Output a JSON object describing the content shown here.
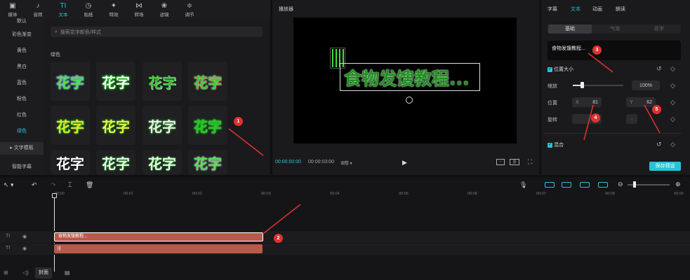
{
  "topnav": {
    "items": [
      {
        "label": "媒体",
        "icon": "▣"
      },
      {
        "label": "音频",
        "icon": "♪"
      },
      {
        "label": "文本",
        "icon": "TI"
      },
      {
        "label": "贴纸",
        "icon": "◷"
      },
      {
        "label": "特效",
        "icon": "✦"
      },
      {
        "label": "转场",
        "icon": "⋈"
      },
      {
        "label": "滤镜",
        "icon": "❀"
      },
      {
        "label": "调节",
        "icon": "≑"
      }
    ]
  },
  "sidebar": {
    "items": [
      "默认",
      "彩色渐变",
      "黄色",
      "黑白",
      "蓝色",
      "粉色",
      "红色",
      "绿色",
      "▸ 文字模板",
      "智能字幕"
    ]
  },
  "library": {
    "search_placeholder": "搜索花字颜色/样式",
    "section": "绿色",
    "tile_text": "花字"
  },
  "player": {
    "title": "播放器",
    "overlay_text": "食物发馊教程...",
    "time_current": "00:00:00:00",
    "time_total": "00:00:03:00",
    "zoom_menu": "调整 ▾"
  },
  "inspector": {
    "tabs": [
      "字幕",
      "文本",
      "动画",
      "朗读"
    ],
    "subtabs": [
      "基础",
      "气泡",
      "花字"
    ],
    "text_value": "食物发馊教程...",
    "position_size_label": "位置大小",
    "scale_label": "缩放",
    "scale_value": "100%",
    "position_label": "位置",
    "x_label": "X",
    "x_value": "81",
    "y_label": "Y",
    "y_value": "62",
    "rotation_label": "旋转",
    "rotation_value": "0°",
    "blend_label": "混合",
    "save_preset": "保存预设"
  },
  "timeline": {
    "ruler": [
      "00:00",
      "00:01",
      "00:02",
      "00:03",
      "00:04",
      "00:05",
      "00:06",
      "00:07",
      "00:08",
      "00:09"
    ],
    "clip1_label": "食物发馊教程...",
    "cover_label": "封面"
  },
  "annotations": [
    "1",
    "2",
    "3",
    "4",
    "5"
  ],
  "colors": {
    "accent": "#29c3d8",
    "clip": "#b85a4a",
    "badge": "#e03131"
  }
}
